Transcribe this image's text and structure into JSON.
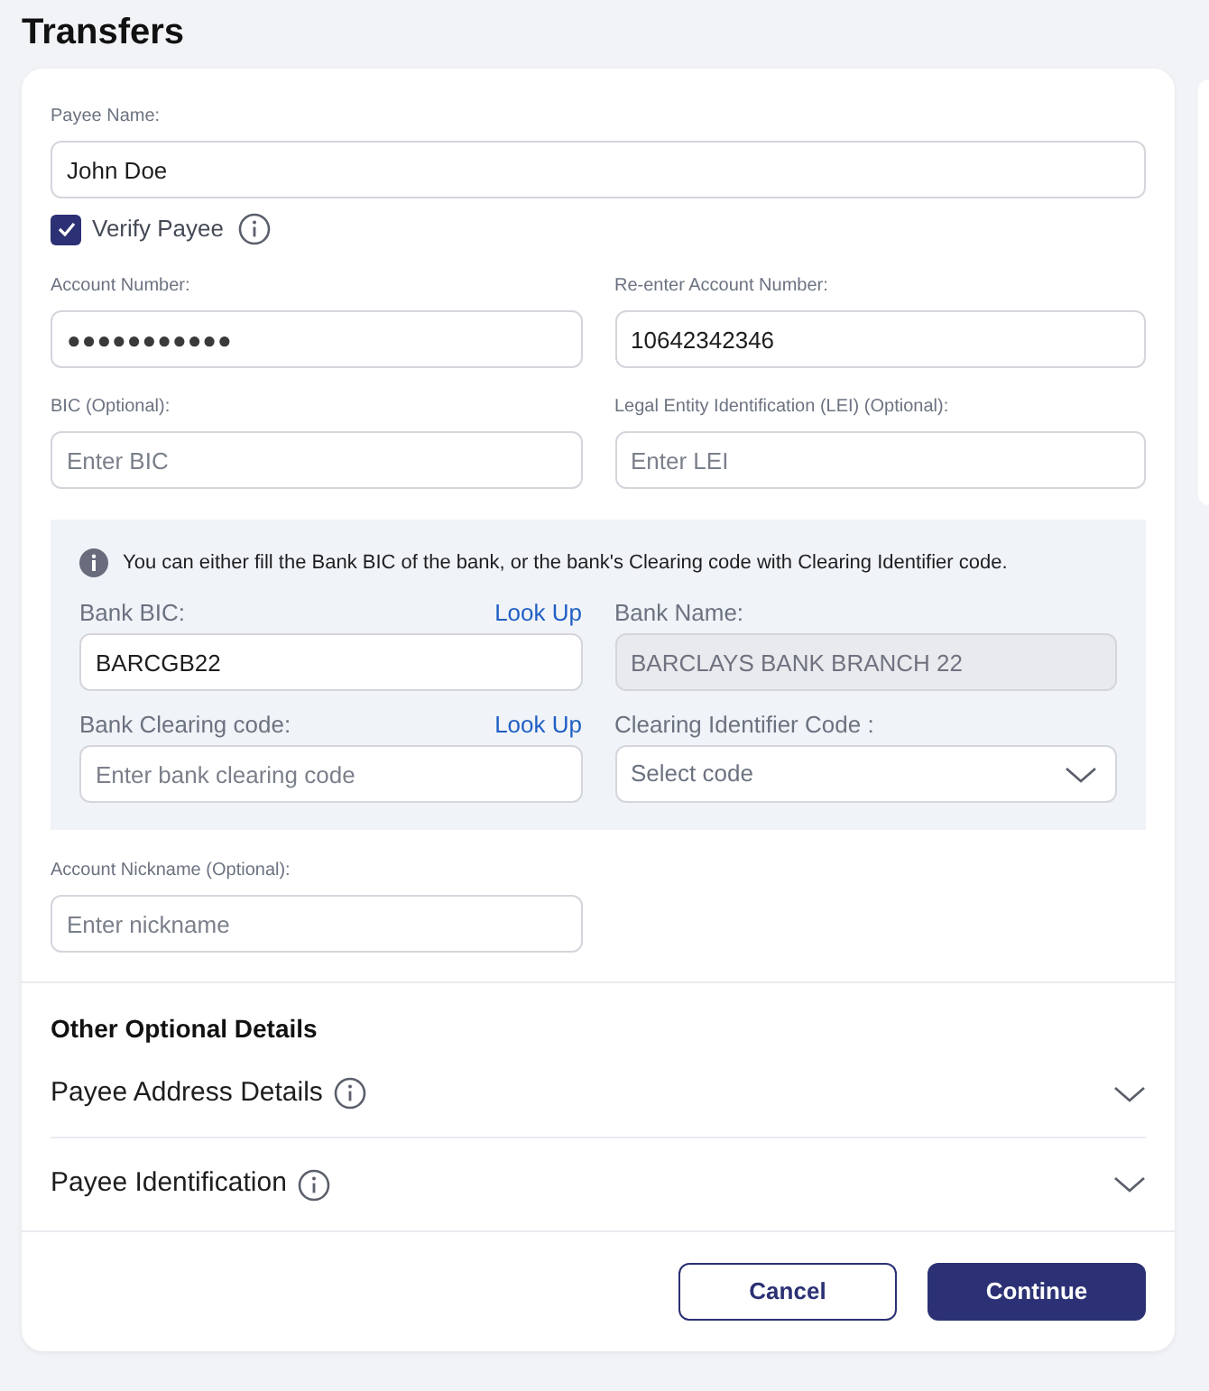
{
  "title": "Transfers",
  "payee_name": {
    "label": "Payee Name:",
    "value": "John Doe"
  },
  "verify_payee": {
    "label": "Verify Payee",
    "checked": true
  },
  "account_fields": [
    {
      "label": "Account Number:",
      "value": "●●●●●●●●●●●",
      "kind": "masked"
    },
    {
      "label": "Re-enter Account Number:",
      "value": "10642342346",
      "kind": "text"
    },
    {
      "label": "BIC (Optional):",
      "placeholder": "Enter BIC",
      "kind": "text"
    },
    {
      "label": "Legal Entity Identification (LEI) (Optional):",
      "placeholder": "Enter LEI",
      "kind": "text"
    }
  ],
  "bank_lookup": {
    "notice": "You can either fill the Bank BIC of the bank, or the bank's Clearing code with Clearing Identifier code.",
    "fields": [
      {
        "label": "Bank BIC:",
        "link": "Look Up",
        "value": "BARCGB22",
        "kind": "text",
        "disabled": false
      },
      {
        "label": "Bank Name:",
        "value": "BARCLAYS BANK BRANCH 22",
        "kind": "text",
        "disabled": true
      },
      {
        "label": "Bank Clearing code:",
        "link": "Look Up",
        "placeholder": "Enter bank clearing code",
        "kind": "text",
        "disabled": false
      },
      {
        "label": "Clearing Identifier Code :",
        "placeholder": "Select code",
        "kind": "select",
        "disabled": false
      }
    ]
  },
  "nickname": {
    "label": "Account Nickname (Optional):",
    "placeholder": "Enter nickname"
  },
  "other_details": {
    "heading": "Other Optional Details",
    "sections": [
      {
        "label": "Payee Address Details",
        "expanded": false
      },
      {
        "label": "Payee Identification",
        "expanded": false
      }
    ]
  },
  "buttons": [
    {
      "label": "Cancel",
      "kind": "secondary"
    },
    {
      "label": "Continue",
      "kind": "primary"
    }
  ]
}
